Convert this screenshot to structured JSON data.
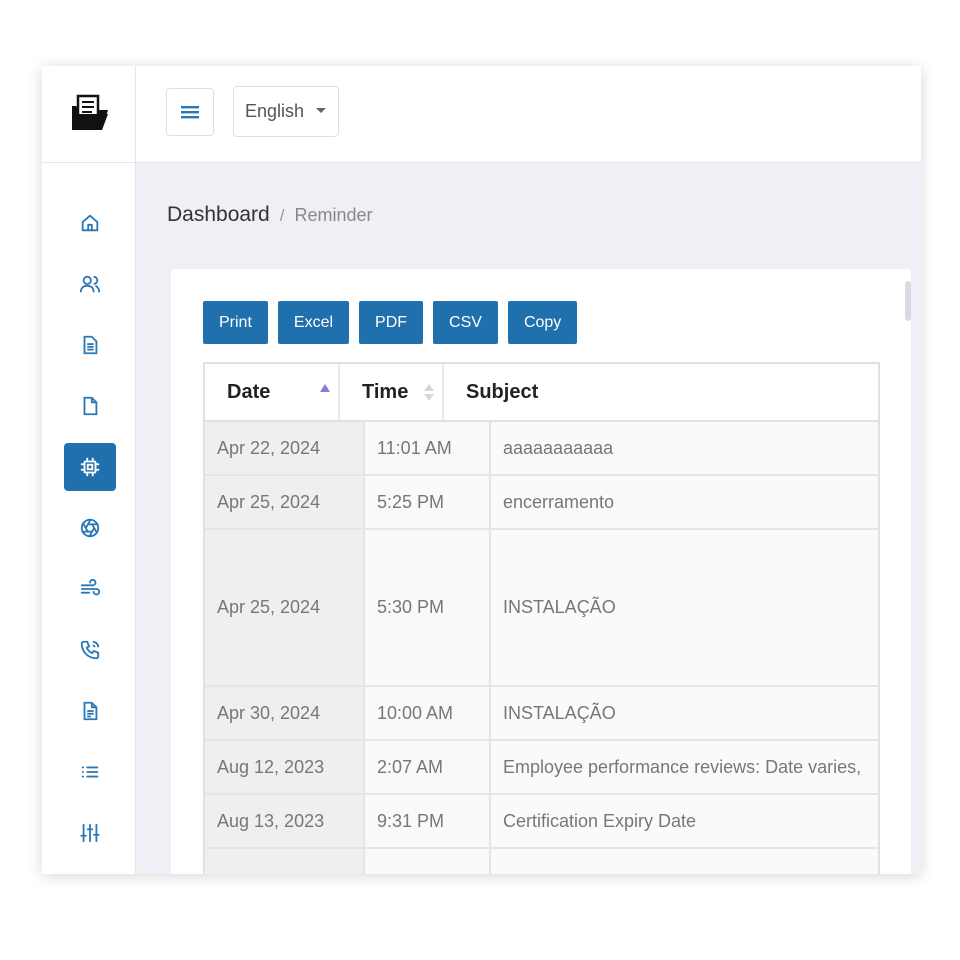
{
  "header": {
    "language": "English"
  },
  "breadcrumb": {
    "home": "Dashboard",
    "separator": "/",
    "current": "Reminder"
  },
  "sidebar": {
    "items": [
      {
        "icon": "home-icon"
      },
      {
        "icon": "users-icon"
      },
      {
        "icon": "document-list-icon"
      },
      {
        "icon": "file-icon"
      },
      {
        "icon": "cpu-chip-icon",
        "active": true
      },
      {
        "icon": "aperture-icon"
      },
      {
        "icon": "wind-icon"
      },
      {
        "icon": "phone-call-icon"
      },
      {
        "icon": "document-lines-icon"
      },
      {
        "icon": "list-icon"
      },
      {
        "icon": "sliders-icon"
      }
    ]
  },
  "toolbar": {
    "print": "Print",
    "excel": "Excel",
    "pdf": "PDF",
    "csv": "CSV",
    "copy": "Copy"
  },
  "table": {
    "headers": {
      "date": "Date",
      "time": "Time",
      "subject": "Subject"
    },
    "rows": [
      {
        "date": "Apr 22, 2024",
        "time": "11:01 AM",
        "subject": "aaaaaaaaaaa"
      },
      {
        "date": "Apr 25, 2024",
        "time": "5:25 PM",
        "subject": "encerramento"
      },
      {
        "date": "Apr 25, 2024",
        "time": "5:30 PM",
        "subject": "INSTALAÇÃO"
      },
      {
        "date": "Apr 30, 2024",
        "time": "10:00 AM",
        "subject": "INSTALAÇÃO"
      },
      {
        "date": "Aug 12, 2023",
        "time": "2:07 AM",
        "subject": "Employee performance reviews: Date varies,"
      },
      {
        "date": "Aug 13, 2023",
        "time": "9:31 PM",
        "subject": "Certification Expiry Date"
      },
      {
        "date": "",
        "time": "",
        "subject": ""
      }
    ]
  },
  "colors": {
    "primary": "#2170ae",
    "icon": "#2b78b5",
    "sort_active": "#8a7bd1"
  }
}
